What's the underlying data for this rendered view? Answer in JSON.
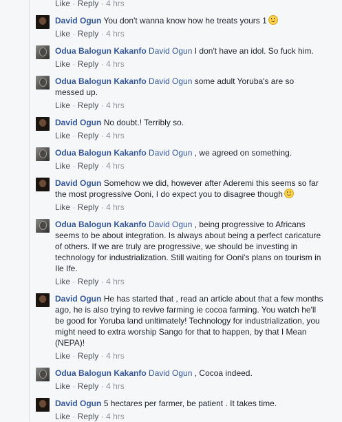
{
  "labels": {
    "like": "Like",
    "reply": "Reply",
    "dot": "·"
  },
  "top": {
    "time": "4 hrs"
  },
  "comments": [
    {
      "author": "David Ogun",
      "mention": "",
      "text": "You don't wanna know how he treats yours 1",
      "emoji": true,
      "time": "4 hrs",
      "avatar": "david-avatar"
    },
    {
      "author": "Odua Balogun Kakanfo",
      "mention": "David Ogun",
      "text": "I don't have an idol. So fuck him.",
      "emoji": false,
      "time": "4 hrs",
      "avatar": "odua-avatar"
    },
    {
      "author": "Odua Balogun Kakanfo",
      "mention": "David Ogun",
      "text": "some adult Yoruba's are so messed up.",
      "emoji": false,
      "time": "4 hrs",
      "avatar": "odua-avatar"
    },
    {
      "author": "David Ogun",
      "mention": "",
      "text": "No doubt.! Terribly so.",
      "emoji": false,
      "time": "4 hrs",
      "avatar": "david-avatar"
    },
    {
      "author": "Odua Balogun Kakanfo",
      "mention": "David Ogun",
      "text": ", we agreed on something.",
      "emoji": false,
      "time": "4 hrs",
      "avatar": "odua-avatar"
    },
    {
      "author": "David Ogun",
      "mention": "",
      "text": "Somehow we did, however after Aderemi this seems so far the most progressive Ooni, I do expect you to disagree though",
      "emoji": true,
      "time": "4 hrs",
      "avatar": "david-avatar"
    },
    {
      "author": "Odua Balogun Kakanfo",
      "mention": "David Ogun",
      "text": ", being progressive to Africans seems to be about integration. Is always about being a perfect caricature of others. If we are truly are progressive, we should be investing in technology for industrialization. Still waiting for Ooni's plans on tourism in Ile Ife.",
      "emoji": false,
      "time": "4 hrs",
      "avatar": "odua-avatar"
    },
    {
      "author": "David Ogun",
      "mention": "",
      "text": "He has started that , read an article about that a few months ago, he is also trying to revive farming ie cocoa farming. You watch he'll be good for Yoruba land unltimately! Technology for industrialization, you might need to extra worship Sango for that to happen, by that I Mean (NEPA)!",
      "emoji": false,
      "time": "4 hrs",
      "avatar": "david-avatar"
    },
    {
      "author": "Odua Balogun Kakanfo",
      "mention": "David Ogun",
      "text": ", Cocoa indeed.",
      "emoji": false,
      "time": "4 hrs",
      "avatar": "odua-avatar"
    },
    {
      "author": "David Ogun",
      "mention": "",
      "text": "5 hectares per farmer, be patient . It takes time.",
      "emoji": false,
      "time": "4 hrs",
      "avatar": "david-avatar"
    }
  ]
}
